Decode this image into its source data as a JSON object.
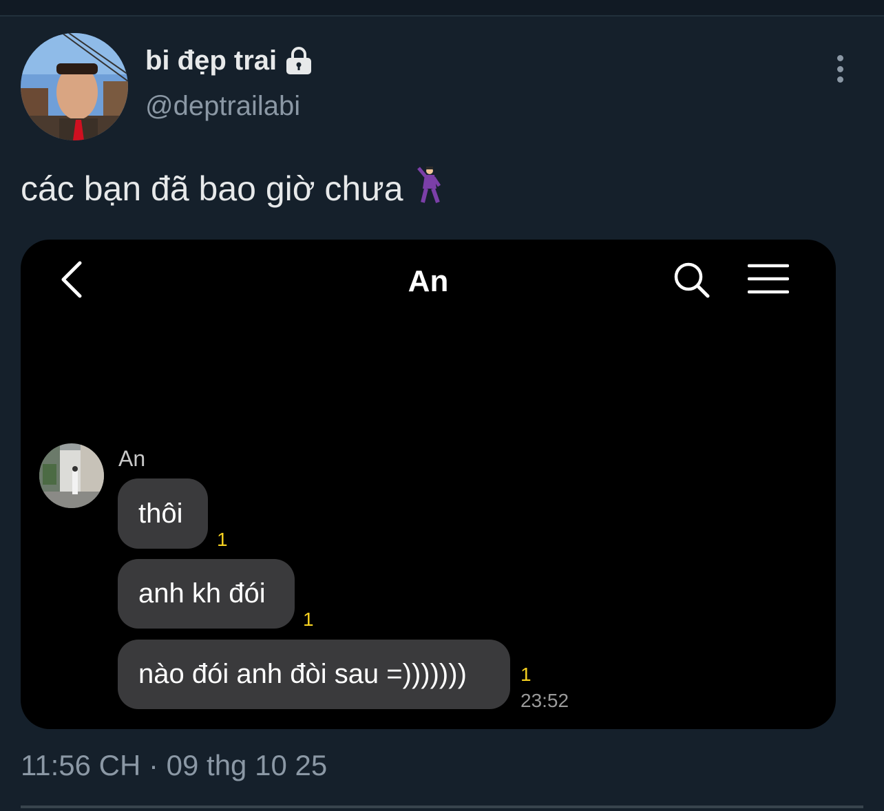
{
  "profile": {
    "display_name": "bi đẹp trai",
    "handle": "@deptrailabi"
  },
  "tweet": {
    "text": "các bạn đã bao giờ chưa",
    "emoji": "🕺",
    "timestamp": "11:56 CH · 09 thg 10 25"
  },
  "chat": {
    "title": "An",
    "sender": "An",
    "messages": [
      {
        "text": "thôi",
        "unread": "1"
      },
      {
        "text": "anh kh đói",
        "unread": "1"
      },
      {
        "text": "nào đói anh đòi sau =)))))))",
        "unread": "1",
        "time": "23:52"
      }
    ]
  },
  "colors": {
    "background": "#15202b",
    "bubble": "#3a3a3c",
    "unread_count": "#f5d020",
    "secondary_text": "#8b98a5"
  },
  "icons": {
    "lock": "lock-icon",
    "more": "more-vertical-icon",
    "back": "chevron-left-icon",
    "search": "search-icon",
    "menu": "hamburger-menu-icon"
  }
}
